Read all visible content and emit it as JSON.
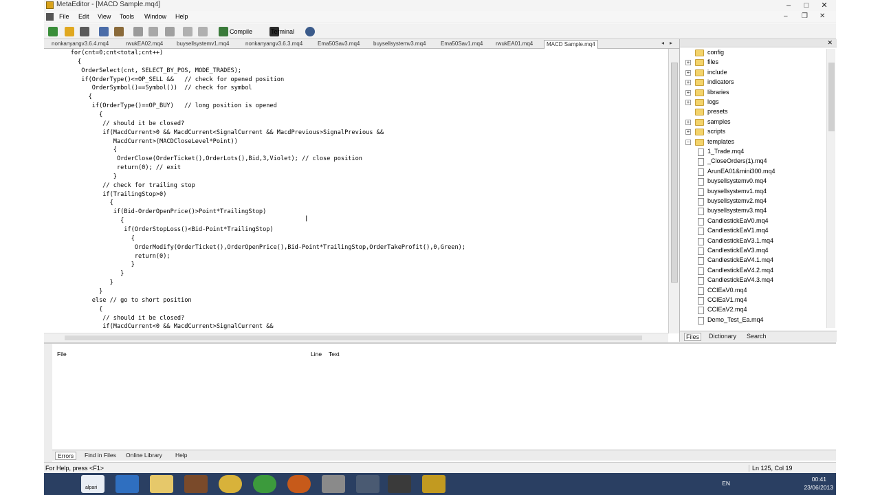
{
  "window": {
    "title": "MetaEditor - [MACD Sample.mq4]"
  },
  "menu": {
    "items": [
      "File",
      "Edit",
      "View",
      "Tools",
      "Window",
      "Help"
    ]
  },
  "toolbar": {
    "compile_label": "Compile",
    "terminal_label": "Terminal"
  },
  "tabs": [
    "nonkanyangv3.6.4.mq4",
    "rwukEA02.mq4",
    "buysellsystemv1.mq4",
    "nonkanyangv3.6.3.mq4",
    "Ema50Sav3.mq4",
    "buysellsystemv3.mq4",
    "Ema50Sav1.mq4",
    "rwukEA01.mq4",
    "MACD Sample.mq4"
  ],
  "active_tab": "MACD Sample.mq4",
  "code_lines": [
    "    for(cnt=0;cnt<total;cnt++)",
    "      {",
    "       OrderSelect(cnt, SELECT_BY_POS, MODE_TRADES);",
    "       if(OrderType()<=OP_SELL &&   // check for opened position",
    "          OrderSymbol()==Symbol())  // check for symbol",
    "         {",
    "          if(OrderType()==OP_BUY)   // long position is opened",
    "            {",
    "             // should it be closed?",
    "             if(MacdCurrent>0 && MacdCurrent<SignalCurrent && MacdPrevious>SignalPrevious &&",
    "                MacdCurrent>(MACDCloseLevel*Point))",
    "                {",
    "                 OrderClose(OrderTicket(),OrderLots(),Bid,3,Violet); // close position",
    "                 return(0); // exit",
    "                }",
    "             // check for trailing stop",
    "             if(TrailingStop>0)",
    "               {",
    "                if(Bid-OrderOpenPrice()>Point*TrailingStop)",
    "                  {",
    "                   if(OrderStopLoss()<Bid-Point*TrailingStop)",
    "                     {",
    "                      OrderModify(OrderTicket(),OrderOpenPrice(),Bid-Point*TrailingStop,OrderTakeProfit(),0,Green);",
    "                      return(0);",
    "                     }",
    "                  }",
    "               }",
    "            }",
    "          else // go to short position",
    "            {",
    "             // should it be closed?",
    "             if(MacdCurrent<0 && MacdCurrent>SignalCurrent &&"
  ],
  "navigator": {
    "folders": [
      "config",
      "files",
      "include",
      "indicators",
      "libraries",
      "logs",
      "presets",
      "samples",
      "scripts",
      "templates"
    ],
    "files": [
      "1_Trade.mq4",
      "_CloseOrders(1).mq4",
      "ArunEA01&mini300.mq4",
      "buysellsystemv0.mq4",
      "buysellsystemv1.mq4",
      "buysellsystemv2.mq4",
      "buysellsystemv3.mq4",
      "CandlestickEaV0.mq4",
      "CandlestickEaV1.mq4",
      "CandlestickEaV3.1.mq4",
      "CandlestickEaV3.mq4",
      "CandlestickEaV4.1.mq4",
      "CandlestickEaV4.2.mq4",
      "CandlestickEaV4.3.mq4",
      "CCIEaV0.mq4",
      "CCIEaV1.mq4",
      "CCIEaV2.mq4",
      "Demo_Test_Ea.mq4"
    ],
    "tabs": [
      "Files",
      "Dictionary",
      "Search"
    ]
  },
  "toolbox": {
    "columns": [
      "File",
      "Line",
      "Text"
    ],
    "tabs": [
      "Errors",
      "Find in Files",
      "Online Library",
      "Help"
    ]
  },
  "status": {
    "help_text": "For Help, press <F1>",
    "position": "Ln 125, Col 19"
  },
  "taskbar": {
    "first_label": "alpari",
    "language": "EN",
    "time": "00:41",
    "date": "23/06/2013"
  }
}
